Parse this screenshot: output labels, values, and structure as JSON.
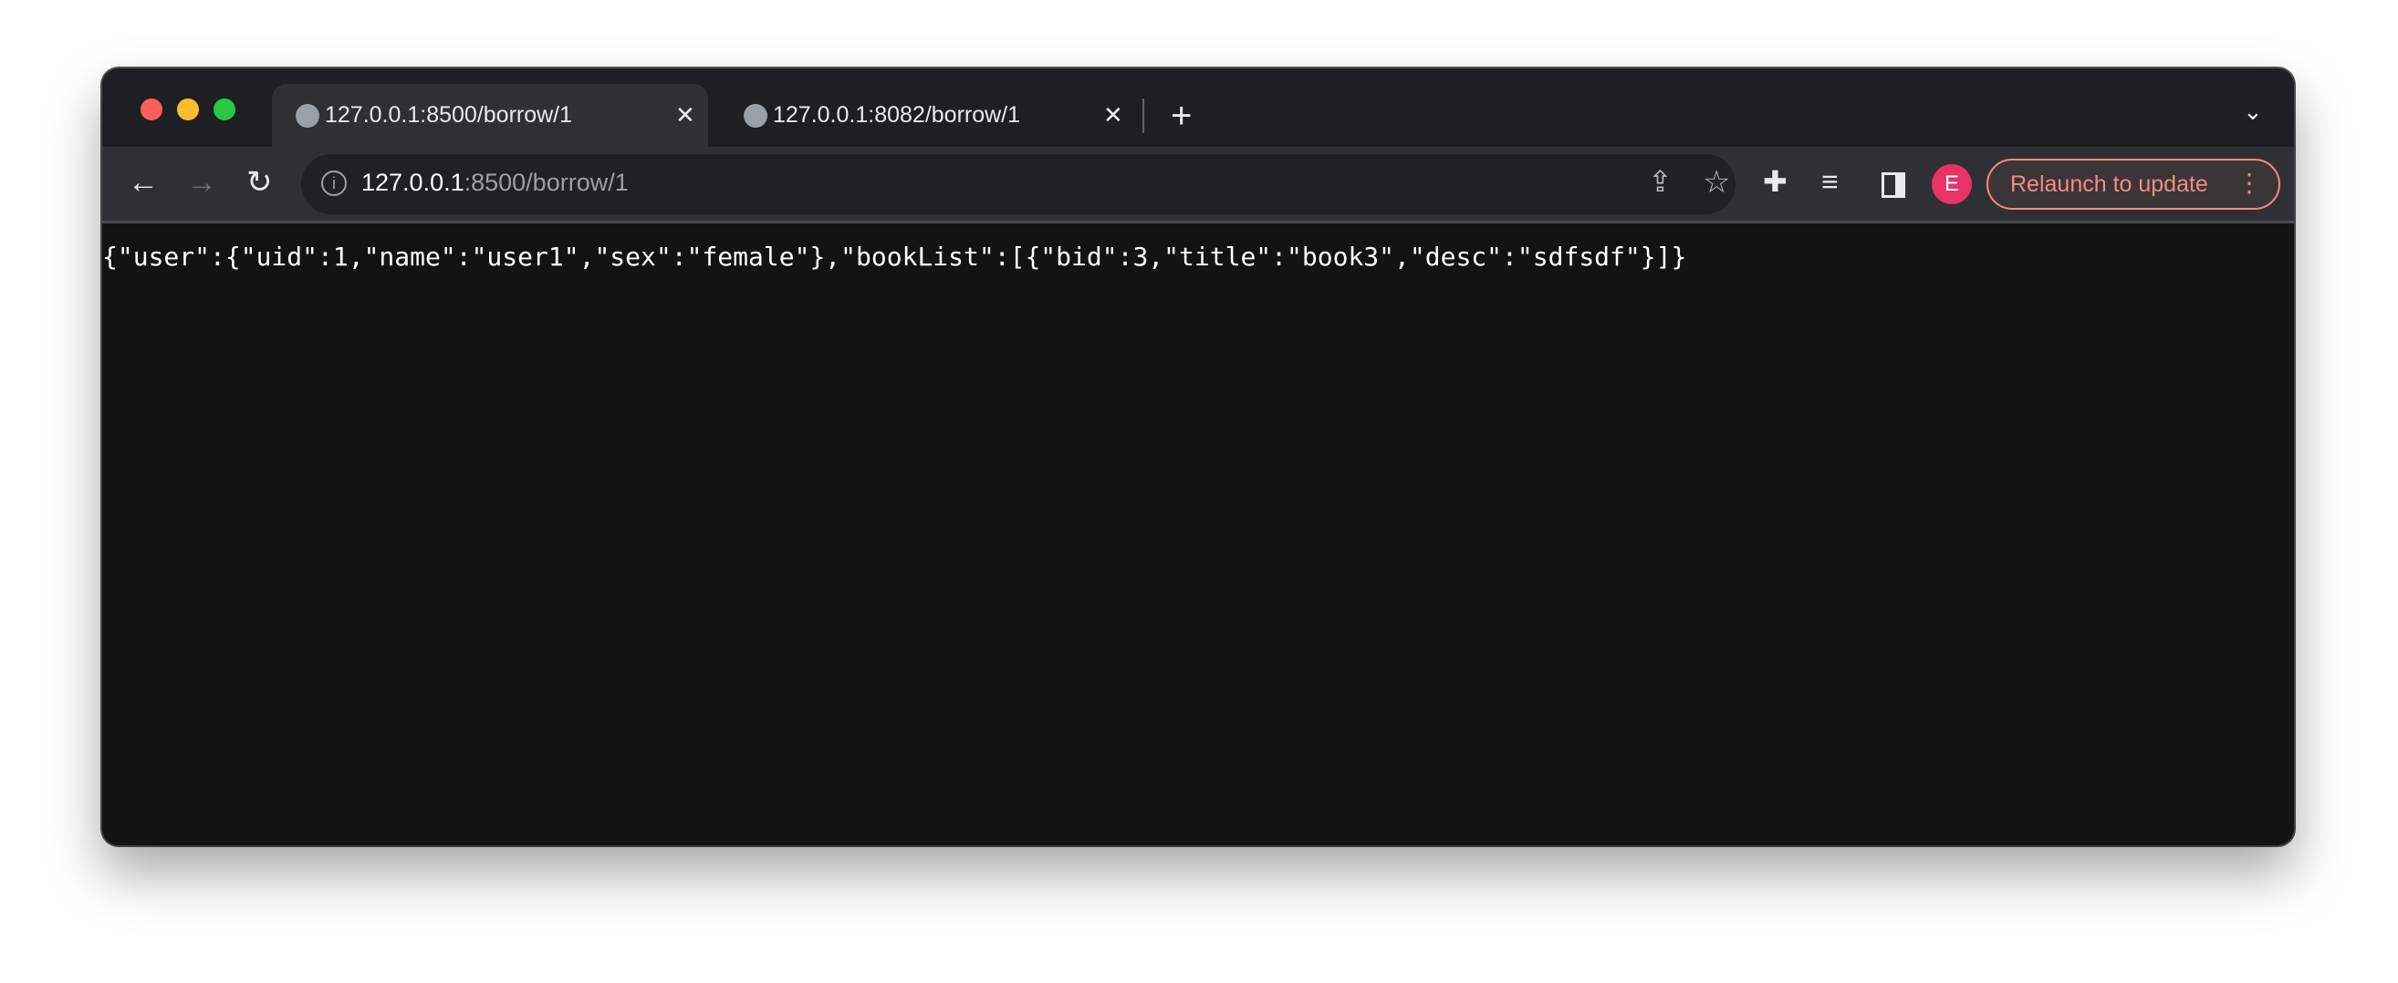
{
  "tabs": [
    {
      "title": "127.0.0.1:8500/borrow/1",
      "active": true
    },
    {
      "title": "127.0.0.1:8082/borrow/1",
      "active": false
    }
  ],
  "address_bar": {
    "host": "127.0.0.1",
    "rest": ":8500/borrow/1"
  },
  "profile": {
    "initial": "E",
    "color": "#e8336a"
  },
  "relaunch_label": "Relaunch to update",
  "page_body": "{\"user\":{\"uid\":1,\"name\":\"user1\",\"sex\":\"female\"},\"bookList\":[{\"bid\":3,\"title\":\"book3\",\"desc\":\"sdfsdf\"}]}",
  "colors": {
    "accent": "#f28b82",
    "close": "#ff5f57",
    "minimize": "#febc2e",
    "maximize": "#28c840"
  },
  "icons": [
    "globe-icon",
    "close-icon",
    "plus-icon",
    "chevron-down-icon",
    "back-icon",
    "forward-icon",
    "reload-icon",
    "info-icon",
    "share-icon",
    "star-icon",
    "extensions-icon",
    "media-queue-icon",
    "side-panel-icon",
    "more-vert-icon"
  ]
}
